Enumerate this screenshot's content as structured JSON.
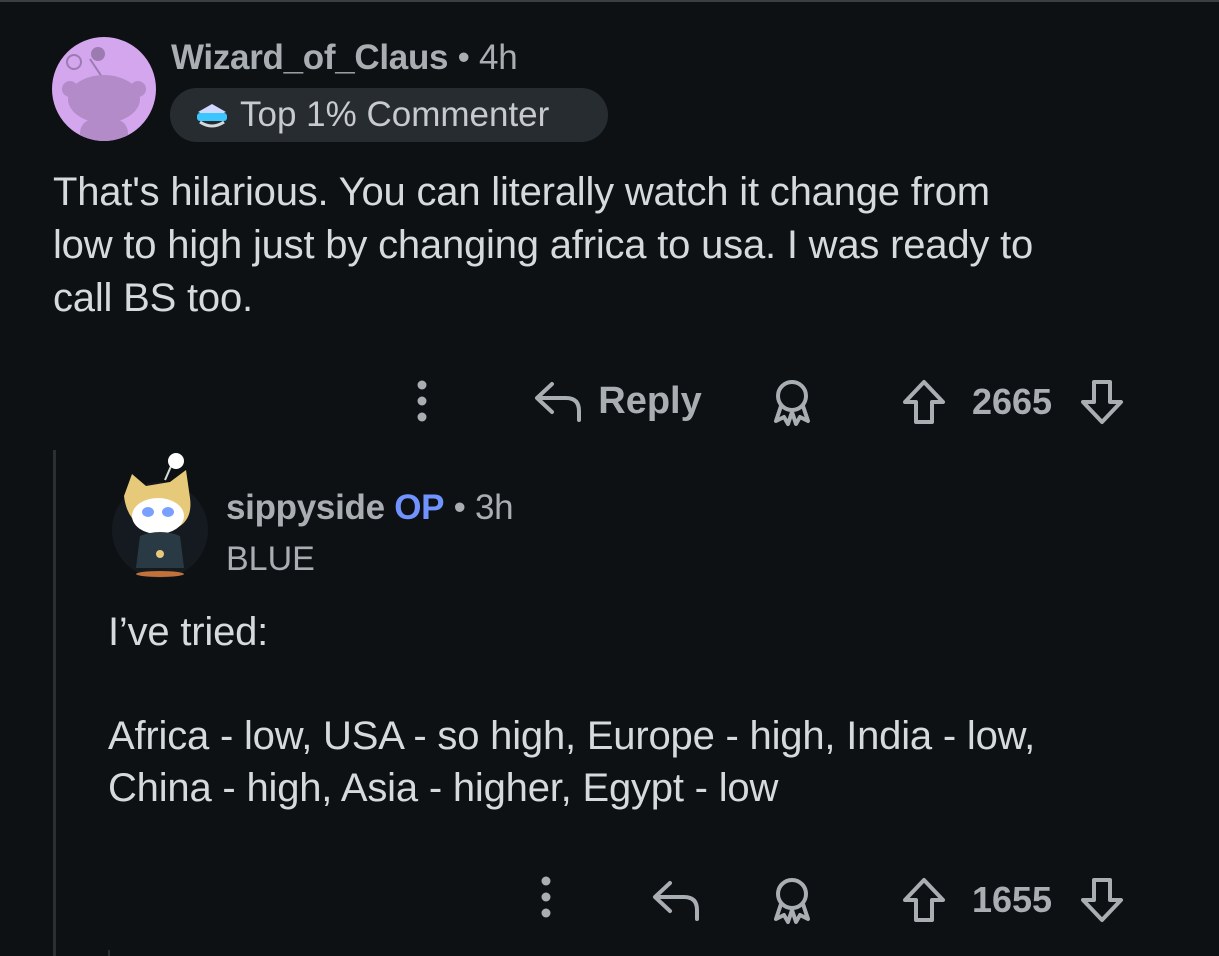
{
  "comments": [
    {
      "author": "Wizard_of_Claus",
      "separator": "•",
      "time": "4h",
      "flair": "Top 1% Commenter",
      "body_lines": [
        "That's hilarious. You can literally watch it change from",
        "low to high just by changing africa to usa. I was ready to",
        "call BS too."
      ],
      "actions": {
        "more_icon": "more-vertical-icon",
        "reply_label": "Reply",
        "award_icon": "award-icon",
        "score": "2665"
      }
    },
    {
      "author": "sippyside",
      "op_badge": "OP",
      "separator": "•",
      "time": "3h",
      "flair": "BLUE",
      "body_lines": [
        "I’ve tried:",
        "",
        "Africa - low, USA - so high, Europe - high, India - low,",
        "China - high, Asia - higher, Egypt - low"
      ],
      "actions": {
        "more_icon": "more-vertical-icon",
        "award_icon": "award-icon",
        "score": "1655"
      }
    }
  ],
  "colors": {
    "background": "#0e1113",
    "text": "#d7dadc",
    "meta": "#a9aeb3",
    "op_badge": "#7193ff",
    "flair_bg": "#272c31",
    "avatar1_bg": "#d4a6ee"
  }
}
